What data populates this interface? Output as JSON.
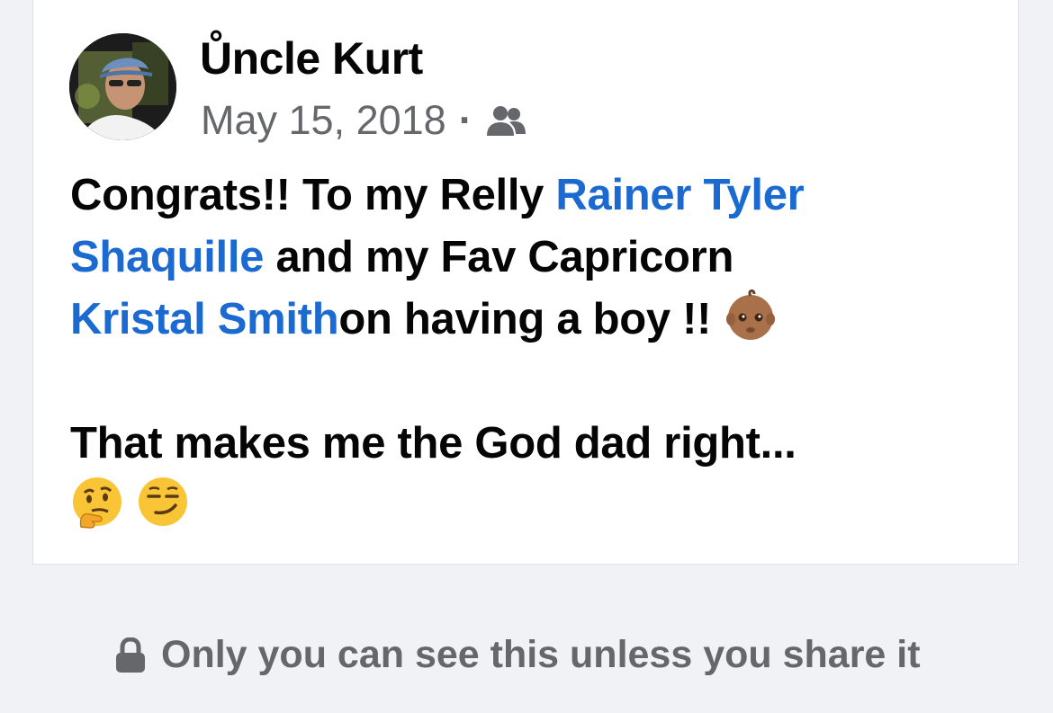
{
  "post": {
    "author": "Ůncle Kurt",
    "date": "May 15, 2018",
    "separator": "·",
    "audience_icon": "friends-icon",
    "text": {
      "line1_prefix": "Congrats!! To my Relly ",
      "mention1": "Rainer Tyler Shaquille",
      "line2_middle": " and my Fav Capricorn ",
      "mention2": "Kristal Smith",
      "line3_suffix": "on having a boy !! ",
      "emoji1": "baby-emoji",
      "line4": "That makes me the God dad right...",
      "emoji2": "thinking-face-emoji",
      "emoji3": "smirking-face-emoji"
    }
  },
  "privacy_notice": {
    "icon": "lock-icon",
    "text": "Only you can see this unless you share it"
  },
  "colors": {
    "mention": "#1b6ad1",
    "text": "#050505",
    "secondary": "#65676b",
    "background": "#f0f2f5",
    "card": "#ffffff"
  }
}
